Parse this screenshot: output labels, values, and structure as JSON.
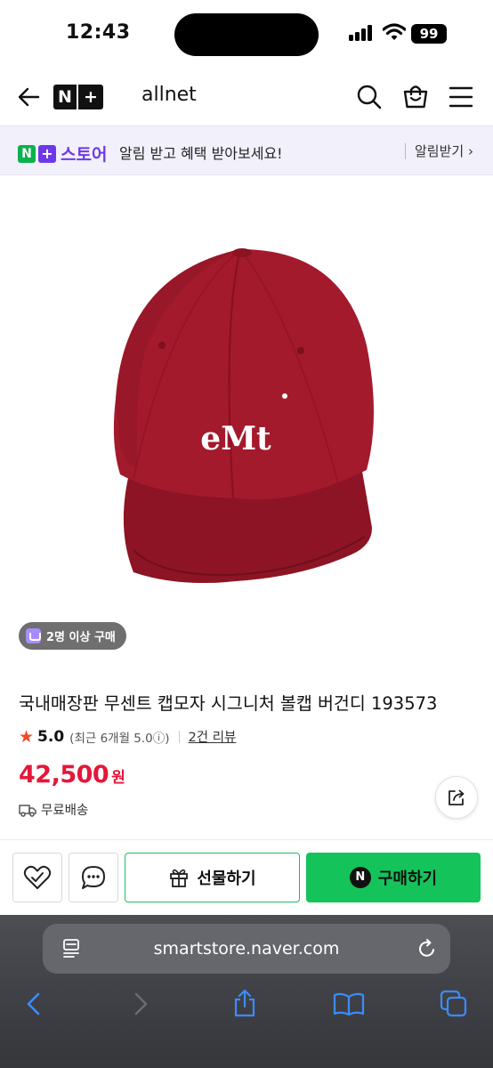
{
  "status": {
    "time": "12:43",
    "battery": "99"
  },
  "header": {
    "store_name": "allnet",
    "logo_n": "N",
    "logo_plus": "+"
  },
  "notice": {
    "logo_n": "N",
    "logo_plus": "+",
    "logo_store": "스토어",
    "text": "알림 받고 혜택 받아보세요!",
    "button": "알림받기 ›"
  },
  "product": {
    "image_logo": "eMt",
    "badge": "2명 이상 구매",
    "title": "국내매장판 무센트 캡모자 시그니처 볼캡 버건디 193573",
    "rating": "5.0",
    "rating_recent": "(최근 6개월 5.0ⓘ)",
    "reviews": "2건 리뷰",
    "price": "42,500",
    "price_unit": "원",
    "shipping": "무료배송"
  },
  "actions": {
    "gift": "선물하기",
    "buy_n": "N",
    "buy": "구매하기"
  },
  "browser": {
    "url": "smartstore.naver.com"
  },
  "colors": {
    "price": "#e4173a",
    "naver_green": "#14c45a",
    "accent_purple": "#6d39e8",
    "cap": "#9b1b2c"
  },
  "icons": [
    "back-icon",
    "search-icon",
    "shopping-bag-icon",
    "menu-icon",
    "star-icon",
    "truck-icon",
    "share-icon",
    "heart-check-icon",
    "chat-icon",
    "gift-icon",
    "reader-icon",
    "reload-icon",
    "browser-back-icon",
    "browser-forward-icon",
    "browser-share-icon",
    "bookmarks-icon",
    "tabs-icon"
  ]
}
